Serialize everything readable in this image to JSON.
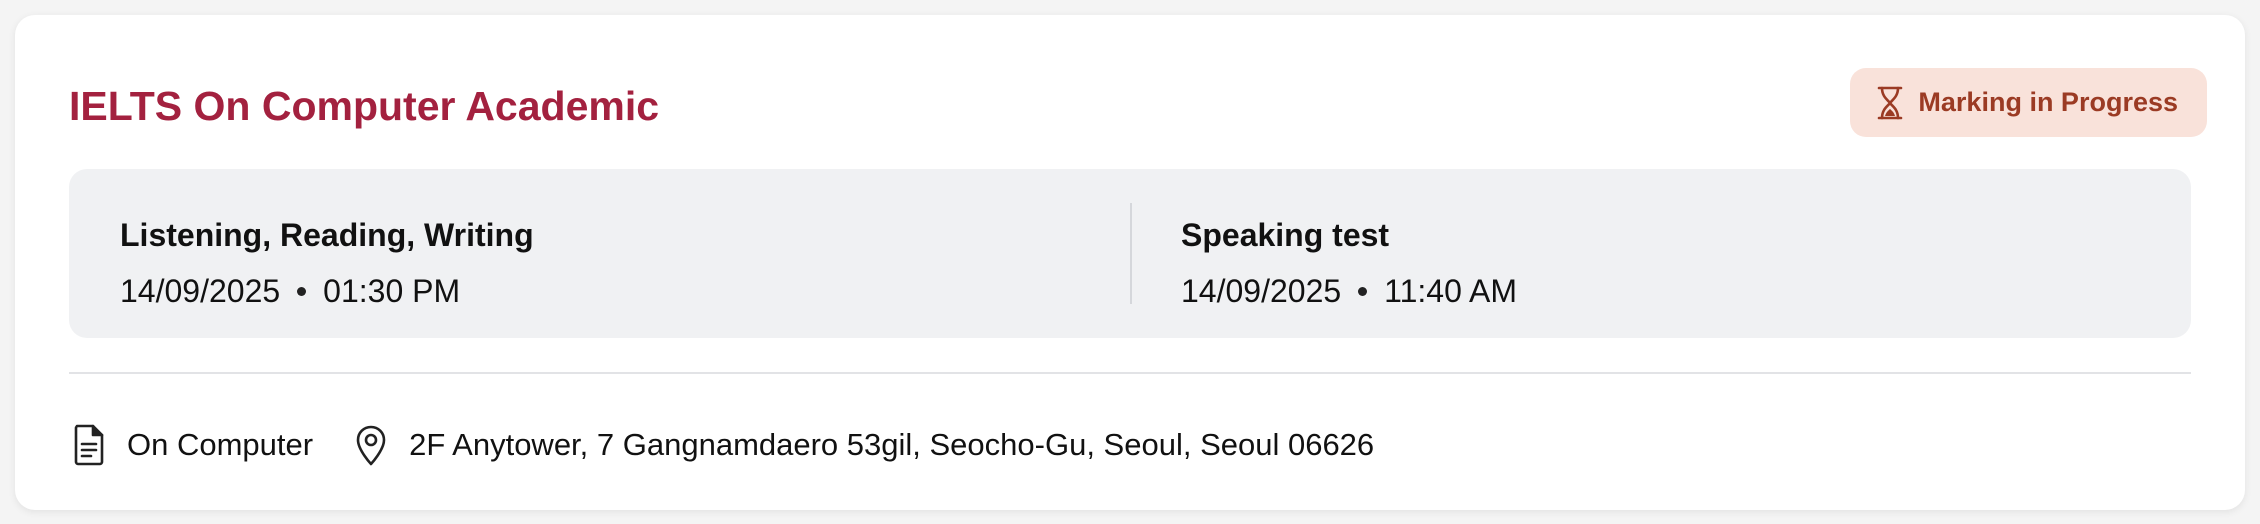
{
  "card": {
    "title": "IELTS On Computer Academic",
    "status": {
      "label": "Marking in Progress",
      "icon": "hourglass-icon",
      "background": "#f9e2da",
      "color": "#9b3b24"
    },
    "sessions": [
      {
        "name": "Listening, Reading, Writing",
        "date": "14/09/2025",
        "time": "01:30 PM"
      },
      {
        "name": "Speaking test",
        "date": "14/09/2025",
        "time": "11:40 AM"
      }
    ],
    "details": {
      "format": {
        "icon": "document-icon",
        "label": "On Computer"
      },
      "location": {
        "icon": "map-pin-icon",
        "address": "2F Anytower, 7 Gangnamdaero 53gil, Seocho-Gu, Seoul, Seoul 06626"
      }
    },
    "accent_color": "#a3213f"
  }
}
